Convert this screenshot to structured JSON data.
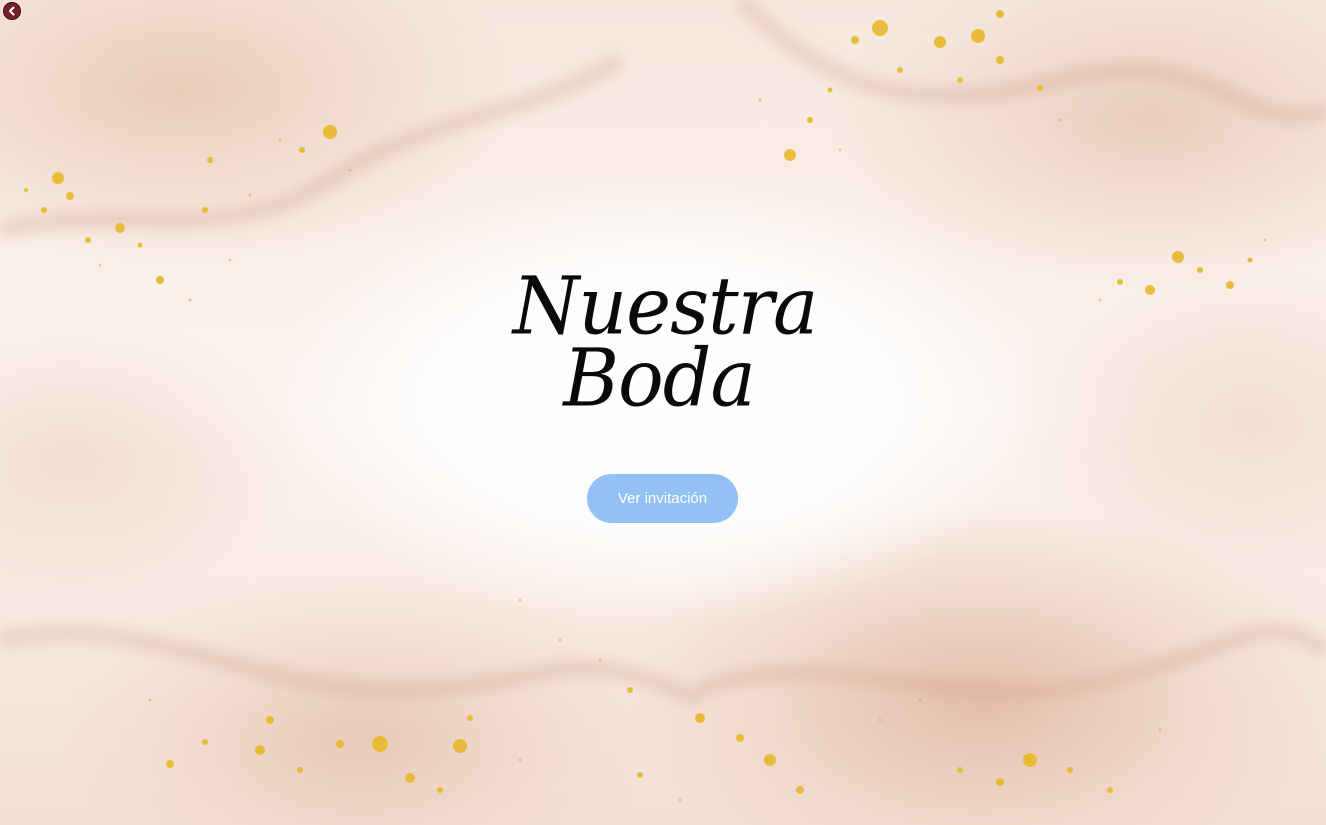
{
  "title": {
    "line1": "Nuestra",
    "line2": "Boda"
  },
  "cta": {
    "label": "Ver invitación"
  },
  "icons": {
    "back": "back-arrow-icon"
  },
  "colors": {
    "button": "#93c1f6",
    "button_text": "#ffffff",
    "title_text": "#0a0a0a",
    "gold": "#e6b82a",
    "back_icon": "#7a1f2a"
  }
}
